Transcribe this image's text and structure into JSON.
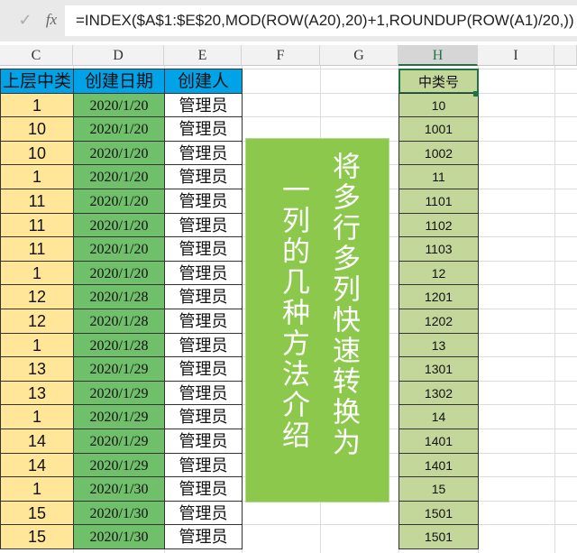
{
  "formula_bar": {
    "check_icon": "✓",
    "fx_label": "fx",
    "formula": "=INDEX($A$1:$E$20,MOD(ROW(A20),20)+1,ROUNDUP(ROW(A1)/20,))"
  },
  "columns": [
    "C",
    "D",
    "E",
    "F",
    "G",
    "H",
    "I"
  ],
  "headers": {
    "c": "上层中类",
    "d": "创建日期",
    "e": "创建人",
    "h": "中类号"
  },
  "rows": [
    {
      "c": "1",
      "d": "2020/1/20",
      "e": "管理员",
      "h": "10"
    },
    {
      "c": "10",
      "d": "2020/1/20",
      "e": "管理员",
      "h": "1001"
    },
    {
      "c": "10",
      "d": "2020/1/20",
      "e": "管理员",
      "h": "1002"
    },
    {
      "c": "1",
      "d": "2020/1/20",
      "e": "管理员",
      "h": "11"
    },
    {
      "c": "11",
      "d": "2020/1/20",
      "e": "管理员",
      "h": "1101"
    },
    {
      "c": "11",
      "d": "2020/1/20",
      "e": "管理员",
      "h": "1102"
    },
    {
      "c": "11",
      "d": "2020/1/20",
      "e": "管理员",
      "h": "1103"
    },
    {
      "c": "1",
      "d": "2020/1/20",
      "e": "管理员",
      "h": "12"
    },
    {
      "c": "12",
      "d": "2020/1/28",
      "e": "管理员",
      "h": "1201"
    },
    {
      "c": "12",
      "d": "2020/1/28",
      "e": "管理员",
      "h": "1202"
    },
    {
      "c": "1",
      "d": "2020/1/28",
      "e": "管理员",
      "h": "13"
    },
    {
      "c": "13",
      "d": "2020/1/29",
      "e": "管理员",
      "h": "1301"
    },
    {
      "c": "13",
      "d": "2020/1/29",
      "e": "管理员",
      "h": "1302"
    },
    {
      "c": "1",
      "d": "2020/1/29",
      "e": "管理员",
      "h": "14"
    },
    {
      "c": "14",
      "d": "2020/1/29",
      "e": "管理员",
      "h": "1401"
    },
    {
      "c": "14",
      "d": "2020/1/29",
      "e": "管理员",
      "h": "1401"
    },
    {
      "c": "1",
      "d": "2020/1/30",
      "e": "管理员",
      "h": "15"
    },
    {
      "c": "15",
      "d": "2020/1/30",
      "e": "管理员",
      "h": "1501"
    },
    {
      "c": "15",
      "d": "2020/1/30",
      "e": "管理员",
      "h": "1501"
    }
  ],
  "banner": {
    "line1": "将多行多列快速转换为",
    "line2": "一列的几种方法介绍"
  },
  "colors": {
    "blue_header": "#00a2e8",
    "yellow": "#ffe699",
    "green": "#70bf6a",
    "olive": "#c4d79b",
    "banner": "#8cc84b"
  }
}
